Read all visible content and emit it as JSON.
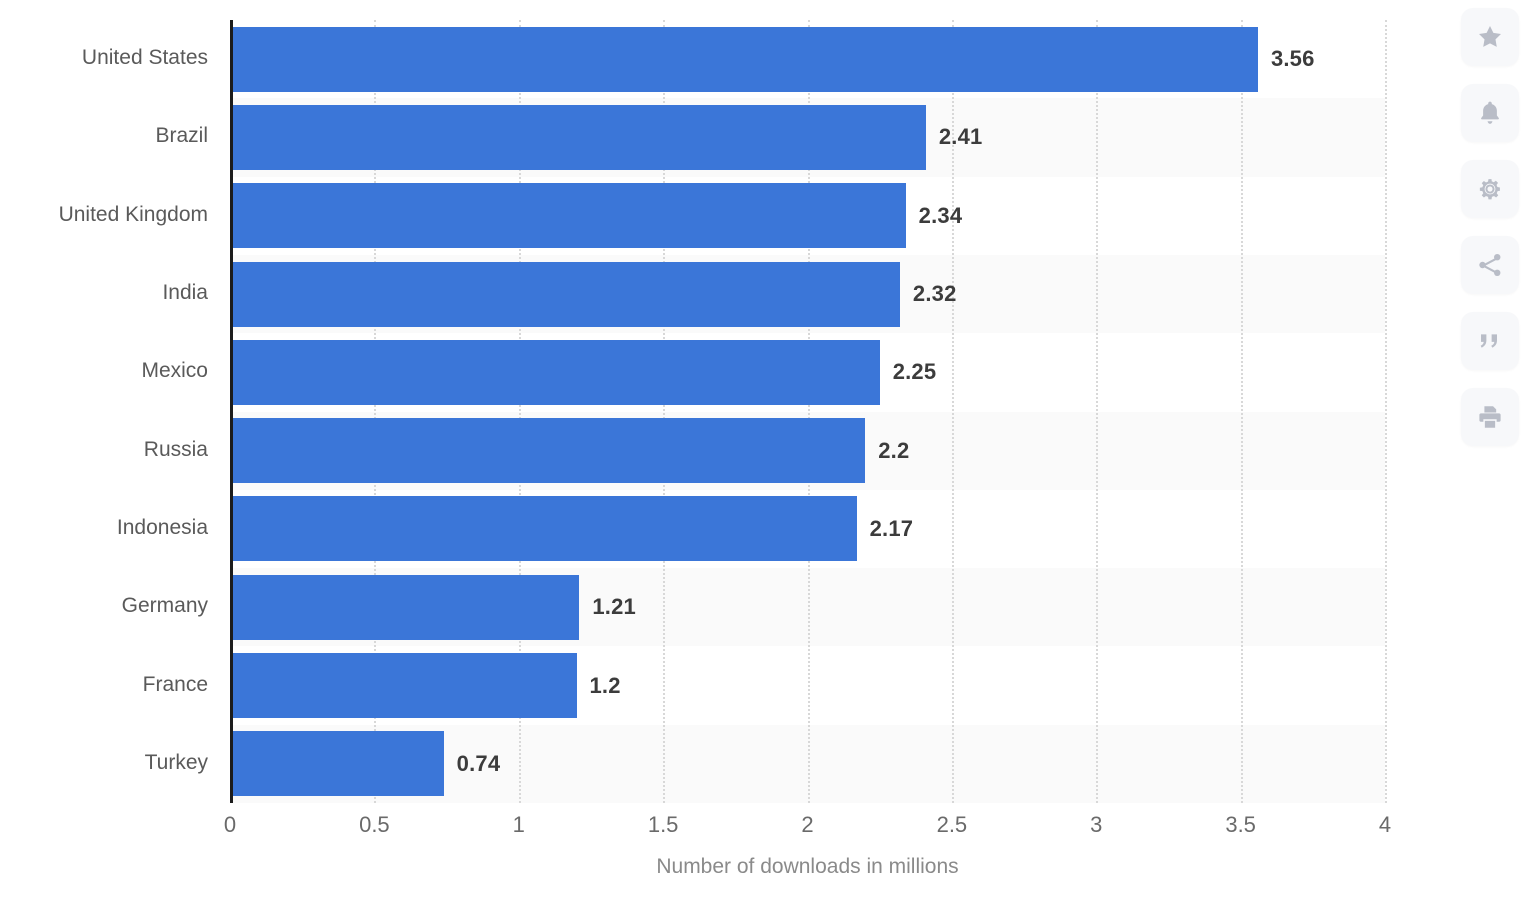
{
  "chart_data": {
    "type": "bar",
    "orientation": "horizontal",
    "title": "",
    "subtitle": "",
    "xlabel": "Number of downloads in millions",
    "ylabel": "",
    "categories": [
      "United States",
      "Brazil",
      "United Kingdom",
      "India",
      "Mexico",
      "Russia",
      "Indonesia",
      "Germany",
      "France",
      "Turkey"
    ],
    "values": [
      3.56,
      2.41,
      2.34,
      2.32,
      2.25,
      2.2,
      2.17,
      1.21,
      1.2,
      0.74
    ],
    "value_labels": [
      "3.56",
      "2.41",
      "2.34",
      "2.32",
      "2.25",
      "2.2",
      "2.17",
      "1.21",
      "1.2",
      "0.74"
    ],
    "xlim": [
      0,
      4
    ],
    "xticks": [
      0,
      0.5,
      1,
      1.5,
      2,
      2.5,
      3,
      3.5,
      4
    ],
    "xtick_labels": [
      "0",
      "0.5",
      "1",
      "1.5",
      "2",
      "2.5",
      "3",
      "3.5",
      "4"
    ],
    "grid": "vertical-dotted",
    "legend": "none",
    "bar_color": "#3b76d8",
    "band_color": "#fafafa",
    "gridline_color": "#d8d8d8",
    "axis_color": "#1c1c1c",
    "value_label_color": "#3c3c3c",
    "category_label_color": "#5a5a5a",
    "tick_label_color": "#6a6a6a",
    "axis_title_color": "#8a8a8a"
  },
  "sidebar": {
    "actions": [
      {
        "name": "favorite-icon",
        "label": "Add to favorites"
      },
      {
        "name": "bell-icon",
        "label": "Notify me"
      },
      {
        "name": "gear-icon",
        "label": "Settings"
      },
      {
        "name": "share-icon",
        "label": "Share"
      },
      {
        "name": "quote-icon",
        "label": "Citation"
      },
      {
        "name": "print-icon",
        "label": "Print"
      }
    ]
  }
}
